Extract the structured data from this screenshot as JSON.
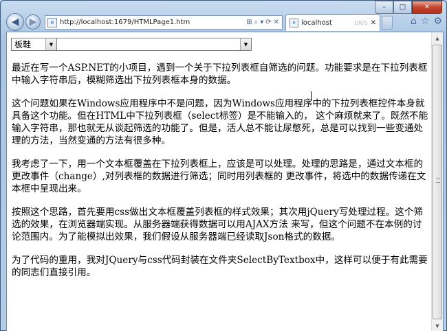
{
  "browser": {
    "address_url": "http://localhost:1679/HTMLPage1.htm",
    "address_icon": "page-icon",
    "tab_title": "localhost",
    "tab_status": "OK/S",
    "toolbar_icons": [
      "home-icon",
      "star-icon",
      "gear-icon"
    ],
    "caption": {
      "minimize": "–",
      "maximize": "□",
      "close": "✕"
    },
    "nav": {
      "back": "◀",
      "forward": "▶"
    },
    "address_tools": [
      "▾",
      "🔍",
      "▾",
      "⟳",
      "✕"
    ]
  },
  "form": {
    "select_value": "板鞋",
    "combo_arrow": "▼"
  },
  "article": {
    "paragraphs": [
      "最近在写一个ASP.NET的小项目，遇到一个关于下拉列表框自筛选的问题。功能要求是在下拉列表框中输入字符串后，模糊筛选出下拉列表框本身的数据。",
      "这个问题如果在Windows应用程序中不是问题，因为Windows应用程序中的下拉列表框控件本身就具备这个功能。但在HTML中下拉列表框（select标签）是不能输入的， 这个麻烦就来了。既然不能输入字符串，那也就无从谈起筛选的功能了。但是，活人总不能让尿憋死，总是可以找到一些变通处理的方法，当然变通的方法有很多种。",
      "我考虑了一下，用一个文本框覆盖在下拉列表框上，应该是可以处理。处理的思路是，通过文本框的更改事件（change）,对列表框的数据进行筛选；同时用列表框的 更改事件，将选中的数据传递在文本框中呈现出来。",
      "按照这个思路，首先要用css做出文本框覆盖列表框的样式效果；其次用jQuery写处理过程。这个筛选的效果，在浏览器端实现。从服务器端获得数据可以用AJAX方法 来写，但这个问题不在本例的讨论范围内。为了能模拟出效果，我们假设从服务器端已经读取Json格式的数据。",
      "为了代码的重用，我对JQuery与css代码封装在文件夹SelectByTextbox中，这样可以便于有此需要的同志们直接引用。"
    ]
  },
  "scrollbar": {
    "up": "▲",
    "down": "▼"
  }
}
